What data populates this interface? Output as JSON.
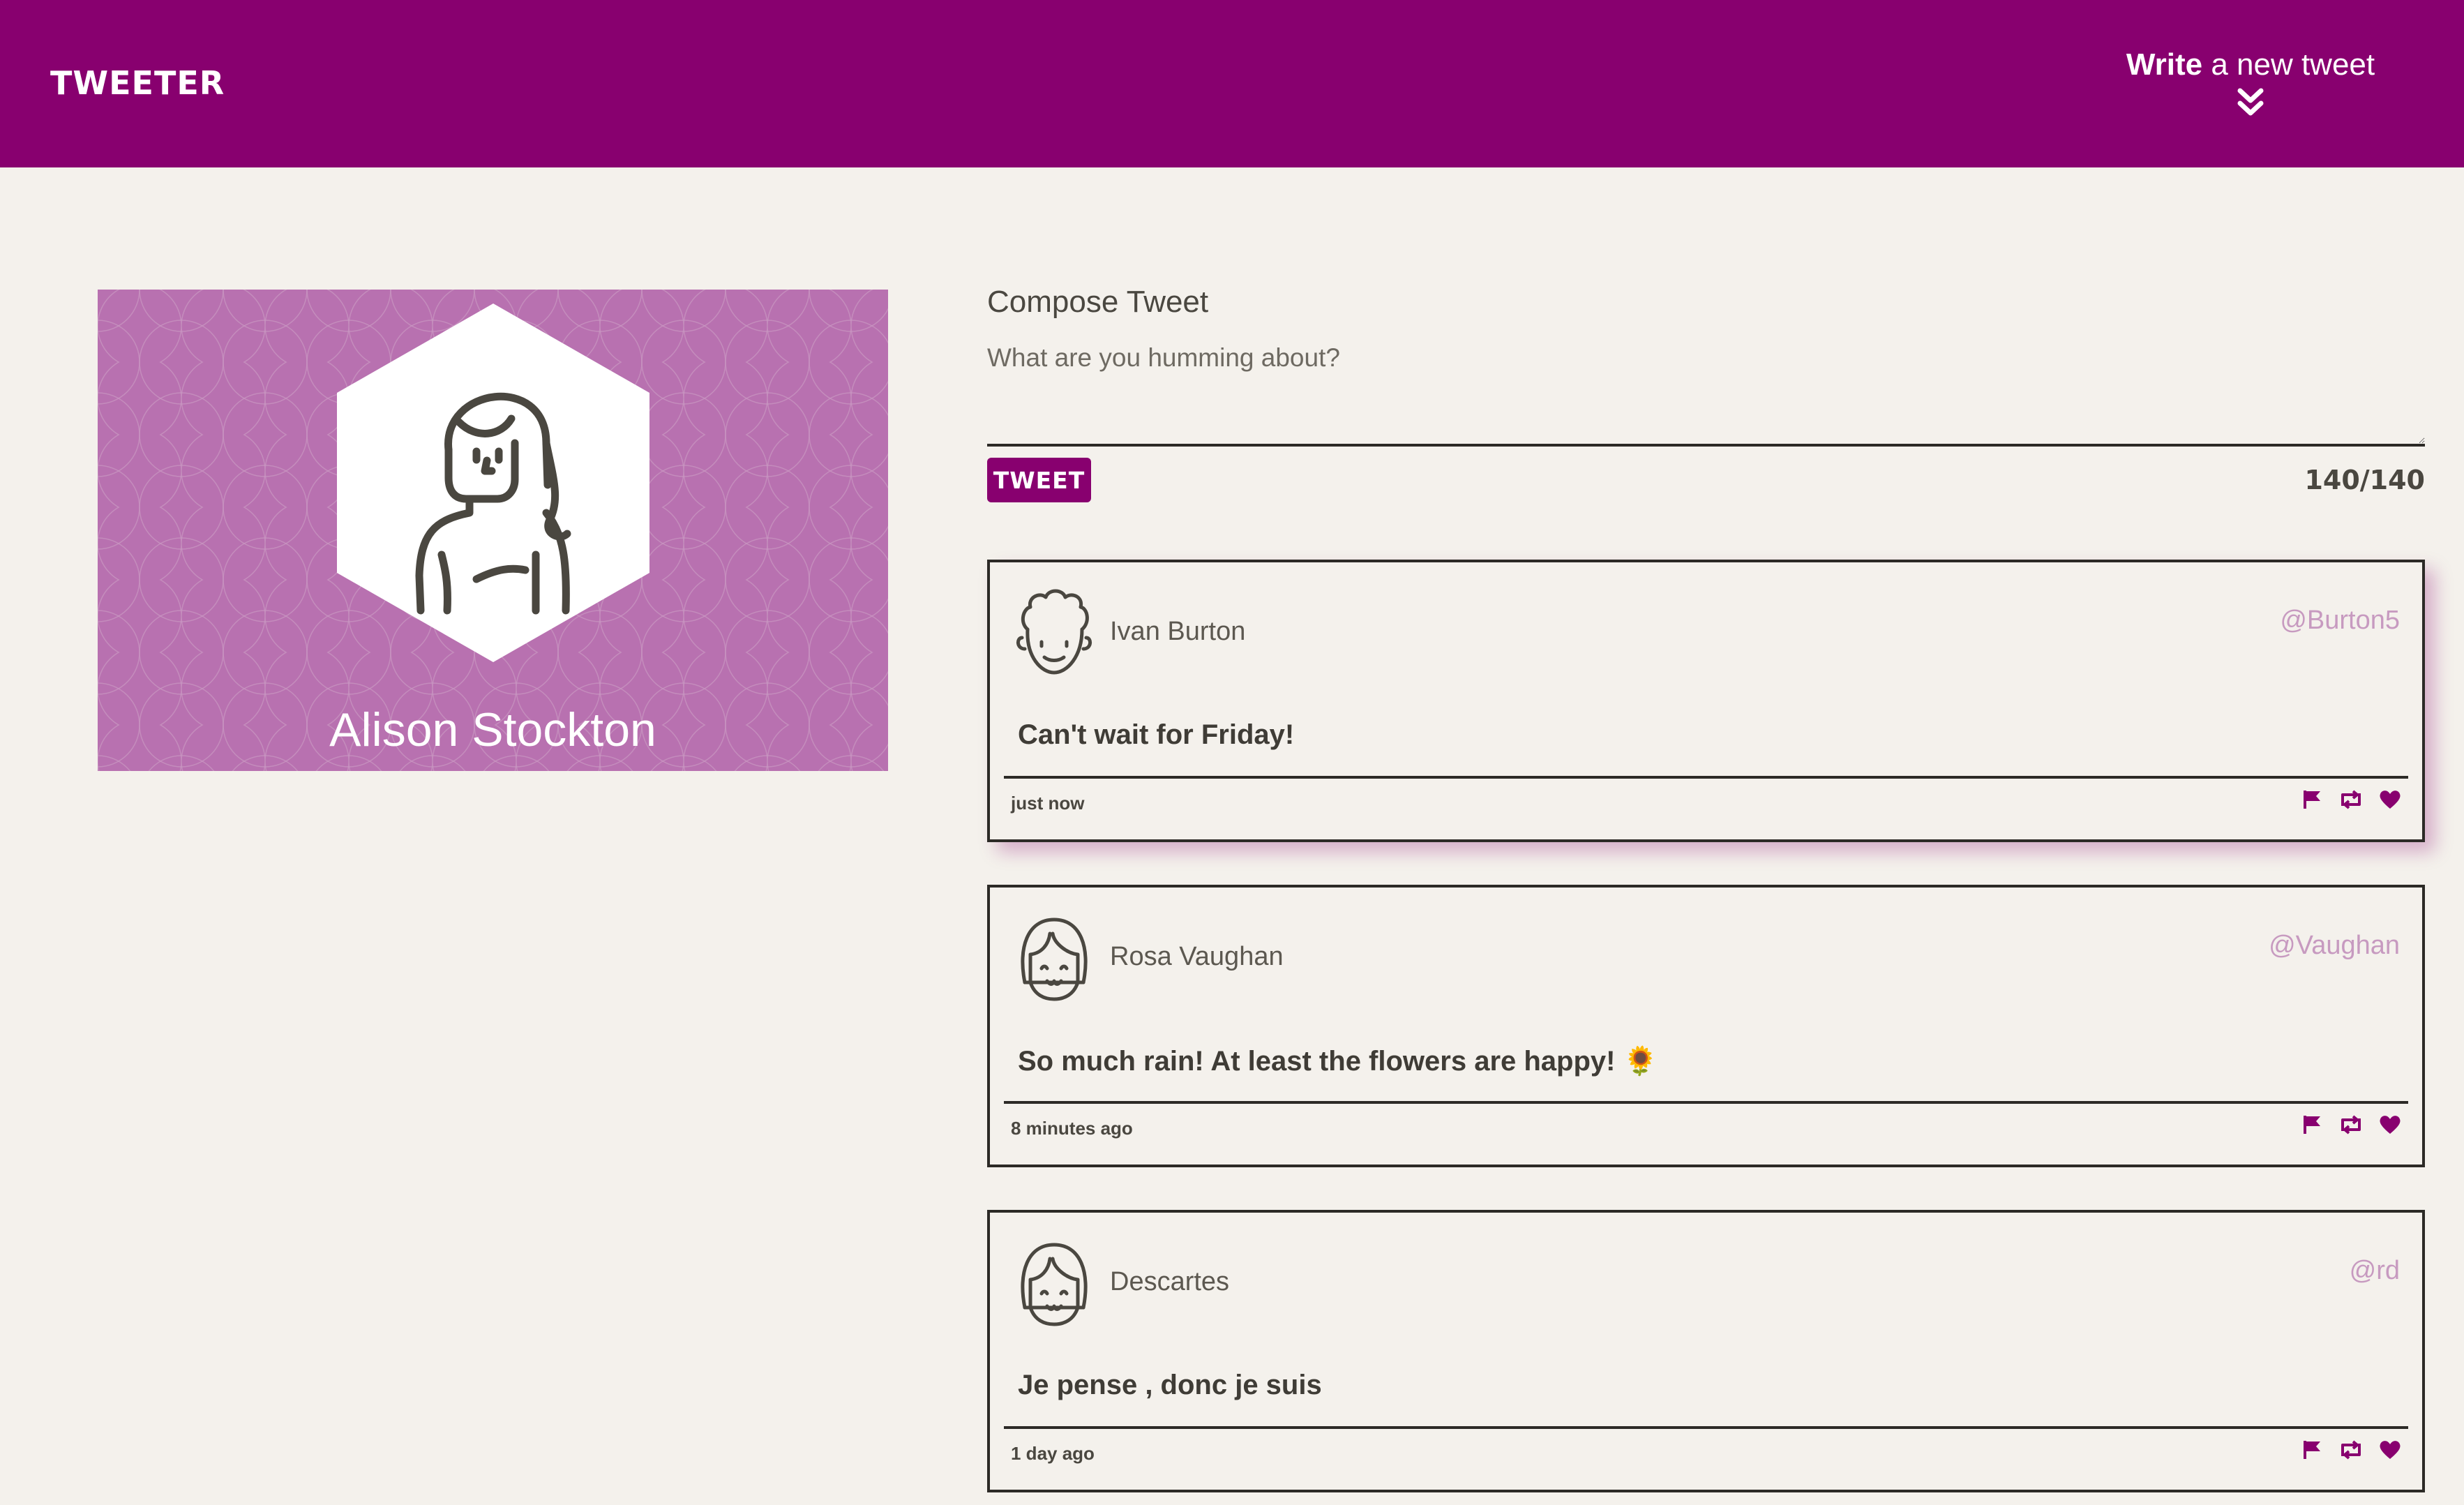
{
  "header": {
    "brand": "TWEETER",
    "compose_bold": "Write",
    "compose_rest": " a new tweet",
    "bg_color": "#88006f"
  },
  "profile": {
    "name": "Alison Stockton",
    "bg_color": "#b871b0"
  },
  "compose": {
    "title": "Compose Tweet",
    "placeholder": "What are you humming about?",
    "value": "",
    "button_label": "TWEET",
    "counter": "140/140"
  },
  "tweets": [
    {
      "name": "Ivan Burton",
      "handle": "@Burton5",
      "content": "Can't wait for Friday!",
      "time": "just now",
      "avatar_icon": "curly-hair-face-icon"
    },
    {
      "name": "Rosa Vaughan",
      "handle": "@Vaughan",
      "content": "So much rain! At least the flowers are happy! 🌻",
      "time": "8 minutes ago",
      "avatar_icon": "bob-hair-face-icon"
    },
    {
      "name": "Descartes",
      "handle": "@rd",
      "content": "Je pense , donc je suis",
      "time": "1 day ago",
      "avatar_icon": "bob-hair-face-icon"
    }
  ],
  "actions": [
    "flag-icon",
    "retweet-icon",
    "heart-icon"
  ],
  "colors": {
    "accent": "#88006f",
    "background": "#f4f1ec",
    "text": "#4a4740",
    "handle": "#c79ac0"
  }
}
